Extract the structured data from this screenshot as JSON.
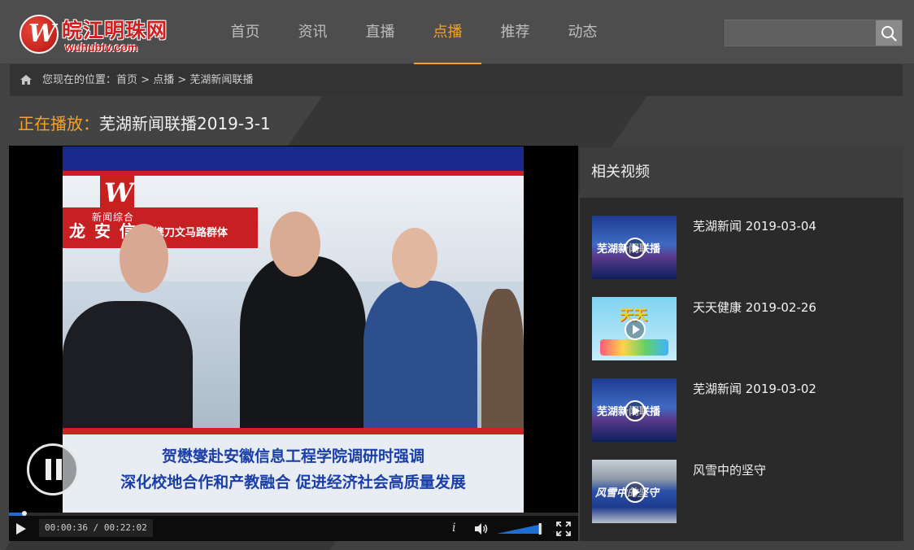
{
  "site": {
    "logo_cn": "皖江明珠网",
    "logo_en": "wuhubtv.com"
  },
  "nav": {
    "items": [
      {
        "label": "首页",
        "active": false
      },
      {
        "label": "资讯",
        "active": false
      },
      {
        "label": "直播",
        "active": false
      },
      {
        "label": "点播",
        "active": true
      },
      {
        "label": "推荐",
        "active": false
      },
      {
        "label": "动态",
        "active": false
      }
    ]
  },
  "search": {
    "placeholder": "",
    "value": ""
  },
  "breadcrumb": {
    "prefix": "您现在的位置：",
    "items": [
      "首页",
      "点播",
      "芜湖新闻联播"
    ],
    "separator": " > "
  },
  "now_playing": {
    "prefix": "正在播放：",
    "title": "芜湖新闻联播2019-3-1"
  },
  "video": {
    "channel_logo_label": "新闻综合",
    "banner_text": "龙 安 信",
    "banner_text_2": "携刀文马路群体",
    "caption_line1": "贺懋燮赴安徽信息工程学院调研时强调",
    "caption_line2": "深化校地合作和产教融合 促进经济社会高质量发展"
  },
  "controls": {
    "current_time": "00:00:36",
    "duration": "00:22:02",
    "time_separator": " / ",
    "progress_fraction": 0.027,
    "volume_fraction": 0.95
  },
  "related": {
    "heading": "相关视频",
    "items": [
      {
        "title": "芜湖新闻 2019-03-04",
        "thumb": "news",
        "thumb_text": "芜湖新闻联播"
      },
      {
        "title": "天天健康 2019-02-26",
        "thumb": "health",
        "thumb_text": "天天"
      },
      {
        "title": "芜湖新闻 2019-03-02",
        "thumb": "news",
        "thumb_text": "芜湖新闻联播"
      },
      {
        "title": "风雪中的坚守",
        "thumb": "snow",
        "thumb_text": "风雪中的坚守"
      }
    ]
  },
  "colors": {
    "accent": "#f7a12a",
    "header_bg": "#4d4d4d",
    "progress": "#1c6fd1"
  }
}
